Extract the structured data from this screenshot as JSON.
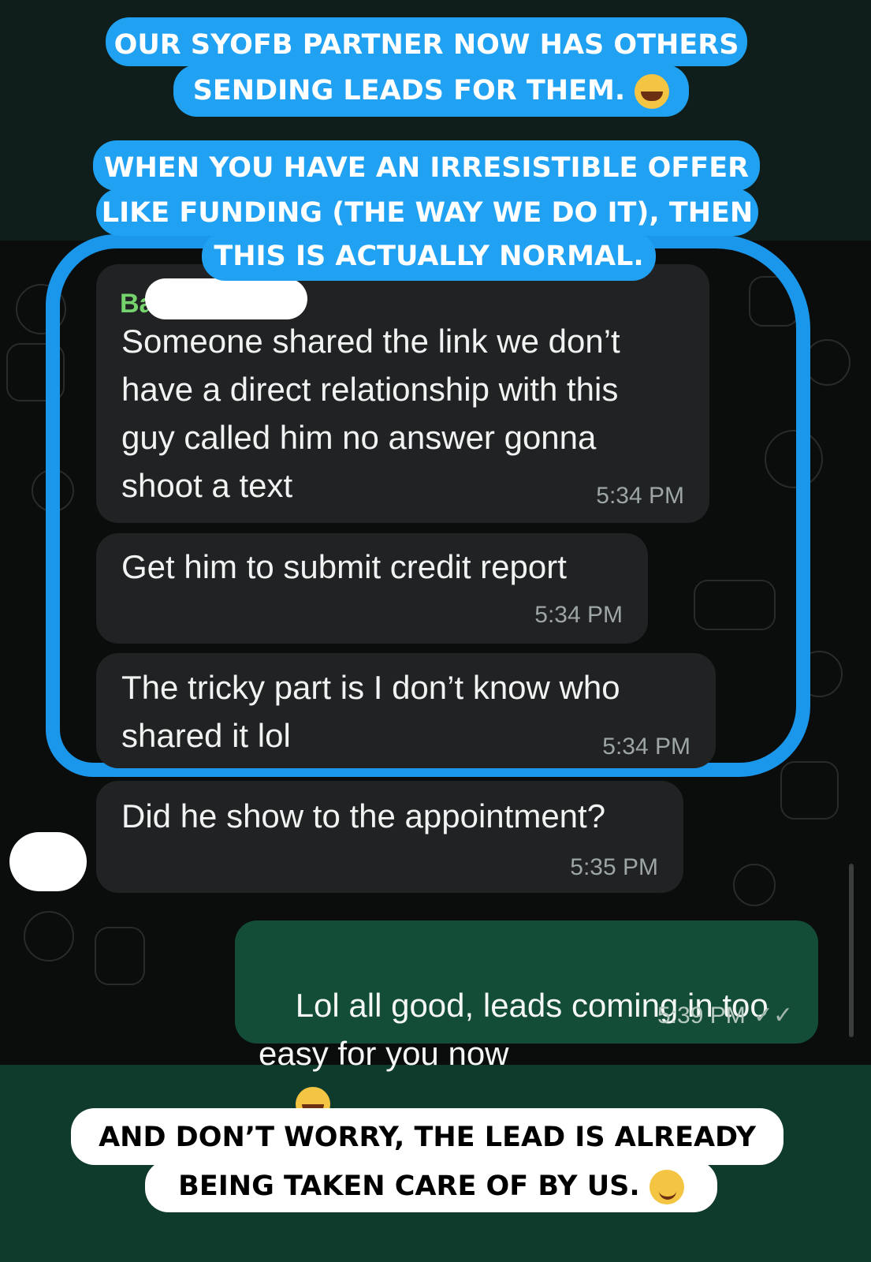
{
  "captions": {
    "top_line1": "OUR SYOFB PARTNER NOW HAS OTHERS",
    "top_line2": "SENDING LEADS FOR THEM.",
    "mid_line1": "WHEN YOU HAVE AN IRRESISTIBLE OFFER",
    "mid_line2": "LIKE FUNDING (THE WAY WE DO IT), THEN",
    "mid_line3": "THIS IS ACTUALLY NORMAL.",
    "bottom_line1": "AND DON’T WORRY, THE LEAD IS ALREADY",
    "bottom_line2": "BEING TAKEN CARE OF BY US."
  },
  "messages": [
    {
      "sender": "Ba",
      "text": "Someone shared the link we don’t\nhave a direct relationship with this\nguy called him no answer gonna\nshoot a text",
      "time": "5:34 PM",
      "direction": "incoming"
    },
    {
      "text": "Get him to submit credit report",
      "time": "5:34 PM",
      "direction": "incoming"
    },
    {
      "text": "The tricky part is I don’t know who\nshared it lol",
      "time": "5:34 PM",
      "direction": "incoming"
    },
    {
      "text": "Did he show to the appointment?",
      "time": "5:35 PM",
      "direction": "incoming"
    },
    {
      "text": "Lol all good, leads coming in too\neasy for you now",
      "time": "5:39 PM",
      "direction": "outgoing",
      "status_icon": "double-check-icon"
    }
  ],
  "icons": {
    "laugh_emoji": "laughing-emoji-icon",
    "wink_emoji": "winking-emoji-icon",
    "read_receipt": "double-check-icon"
  },
  "colors": {
    "caption_blue": "#21a1f2",
    "incoming_bubble": "#202223",
    "outgoing_bubble": "#144d37",
    "sender_name": "#75d36d"
  }
}
